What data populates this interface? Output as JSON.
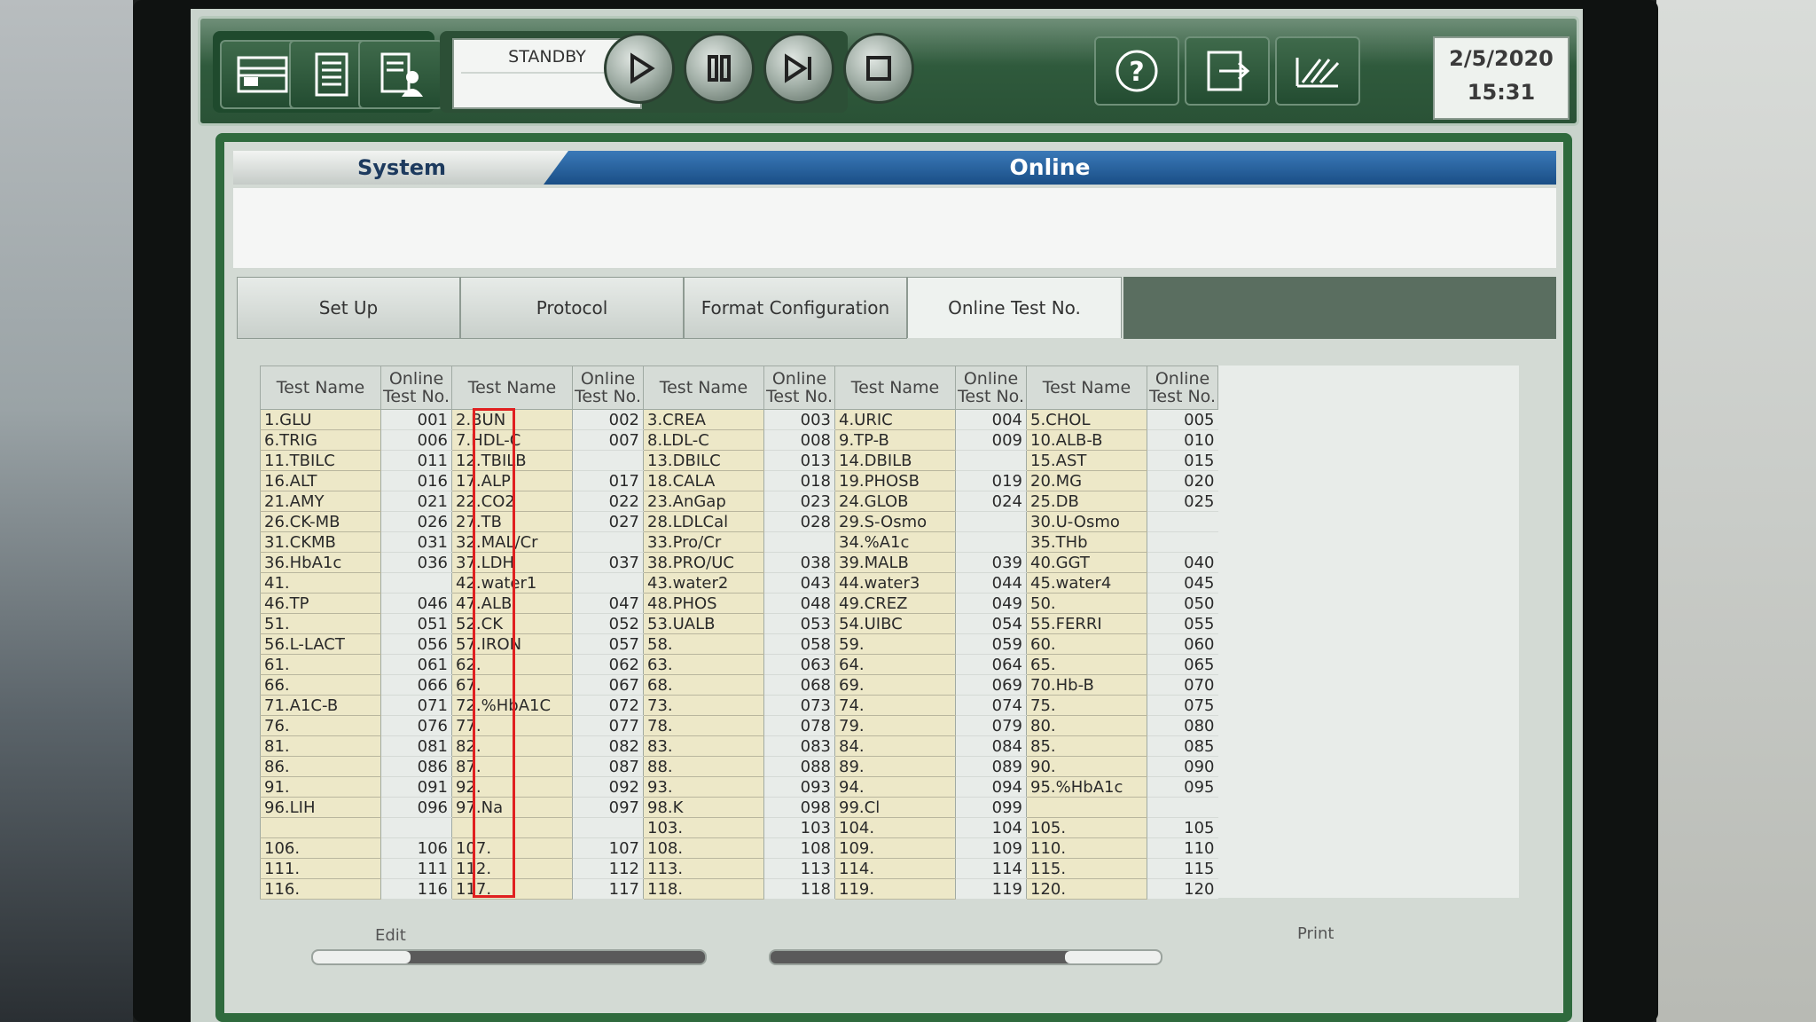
{
  "toolbar": {
    "status": "STANDBY",
    "date": "2/5/2020",
    "time": "15:31"
  },
  "header": {
    "system_label": "System",
    "mode_label": "Online"
  },
  "tabs": [
    "Set Up",
    "Protocol",
    "Format Configuration",
    "Online Test No."
  ],
  "table": {
    "col_test_name": "Test Name",
    "col_online_1": "Online",
    "col_online_2": "Test No.",
    "rows": [
      [
        "1.GLU",
        "001",
        "2.BUN",
        "002",
        "3.CREA",
        "003",
        "4.URIC",
        "004",
        "5.CHOL",
        "005"
      ],
      [
        "6.TRIG",
        "006",
        "7.HDL-C",
        "007",
        "8.LDL-C",
        "008",
        "9.TP-B",
        "009",
        "10.ALB-B",
        "010"
      ],
      [
        "11.TBILC",
        "011",
        "12.TBILB",
        "",
        "13.DBILC",
        "013",
        "14.DBILB",
        "",
        "15.AST",
        "015"
      ],
      [
        "16.ALT",
        "016",
        "17.ALP",
        "017",
        "18.CALA",
        "018",
        "19.PHOSB",
        "019",
        "20.MG",
        "020"
      ],
      [
        "21.AMY",
        "021",
        "22.CO2",
        "022",
        "23.AnGap",
        "023",
        "24.GLOB",
        "024",
        "25.DB",
        "025"
      ],
      [
        "26.CK-MB",
        "026",
        "27.TB",
        "027",
        "28.LDLCal",
        "028",
        "29.S-Osmo",
        "",
        "30.U-Osmo",
        ""
      ],
      [
        "31.CKMB",
        "031",
        "32.MAL/Cr",
        "",
        "33.Pro/Cr",
        "",
        "34.%A1c",
        "",
        "35.THb",
        ""
      ],
      [
        "36.HbA1c",
        "036",
        "37.LDH",
        "037",
        "38.PRO/UC",
        "038",
        "39.MALB",
        "039",
        "40.GGT",
        "040"
      ],
      [
        "41.",
        "",
        "42.water1",
        "",
        "43.water2",
        "043",
        "44.water3",
        "044",
        "45.water4",
        "045"
      ],
      [
        "46.TP",
        "046",
        "47.ALB",
        "047",
        "48.PHOS",
        "048",
        "49.CREZ",
        "049",
        "50.",
        "050"
      ],
      [
        "51.",
        "051",
        "52.CK",
        "052",
        "53.UALB",
        "053",
        "54.UIBC",
        "054",
        "55.FERRI",
        "055"
      ],
      [
        "56.L-LACT",
        "056",
        "57.IRON",
        "057",
        "58.",
        "058",
        "59.",
        "059",
        "60.",
        "060"
      ],
      [
        "61.",
        "061",
        "62.",
        "062",
        "63.",
        "063",
        "64.",
        "064",
        "65.",
        "065"
      ],
      [
        "66.",
        "066",
        "67.",
        "067",
        "68.",
        "068",
        "69.",
        "069",
        "70.Hb-B",
        "070"
      ],
      [
        "71.A1C-B",
        "071",
        "72.%HbA1C",
        "072",
        "73.",
        "073",
        "74.",
        "074",
        "75.",
        "075"
      ],
      [
        "76.",
        "076",
        "77.",
        "077",
        "78.",
        "078",
        "79.",
        "079",
        "80.",
        "080"
      ],
      [
        "81.",
        "081",
        "82.",
        "082",
        "83.",
        "083",
        "84.",
        "084",
        "85.",
        "085"
      ],
      [
        "86.",
        "086",
        "87.",
        "087",
        "88.",
        "088",
        "89.",
        "089",
        "90.",
        "090"
      ],
      [
        "91.",
        "091",
        "92.",
        "092",
        "93.",
        "093",
        "94.",
        "094",
        "95.%HbA1c",
        "095"
      ],
      [
        "96.LIH",
        "096",
        "97.Na",
        "097",
        "98.K",
        "098",
        "99.Cl",
        "099",
        "",
        ""
      ],
      [
        "",
        "",
        "",
        "",
        "103.",
        "103",
        "104.",
        "104",
        "105.",
        "105"
      ],
      [
        "106.",
        "106",
        "107.",
        "107",
        "108.",
        "108",
        "109.",
        "109",
        "110.",
        "110"
      ],
      [
        "111.",
        "111",
        "112.",
        "112",
        "113.",
        "113",
        "114.",
        "114",
        "115.",
        "115"
      ],
      [
        "116.",
        "116",
        "117.",
        "117",
        "118.",
        "118",
        "119.",
        "119",
        "120.",
        "120"
      ]
    ]
  },
  "footer": {
    "edit_label": "Edit",
    "print_label": "Print"
  }
}
